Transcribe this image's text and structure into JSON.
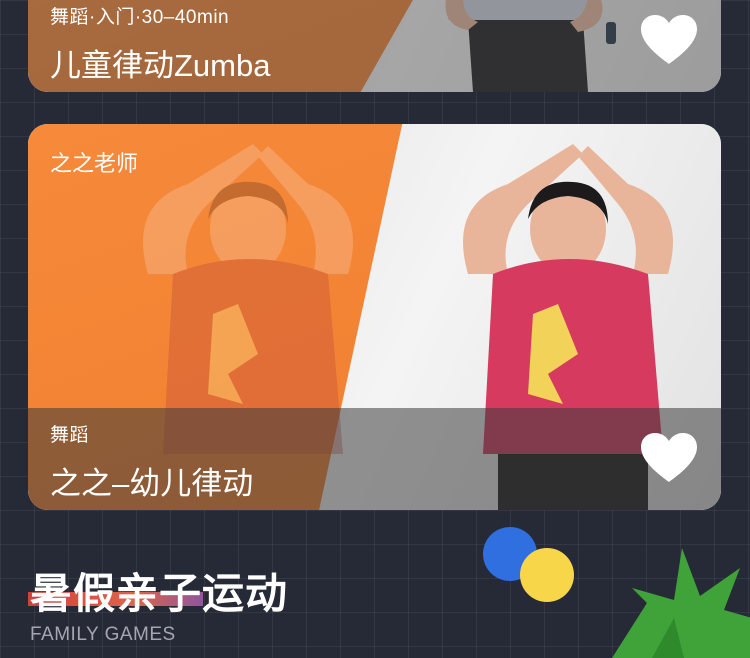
{
  "cards": [
    {
      "tag": "舞蹈·入门·30–40min",
      "title": "儿童律动Zumba",
      "favorite_icon": "heart-icon"
    },
    {
      "teacher": "之之老师",
      "tag": "舞蹈",
      "title": "之之–幼儿律动",
      "favorite_icon": "heart-icon"
    }
  ],
  "section": {
    "title": "暑假亲子运动",
    "subtitle": "FAMILY GAMES"
  },
  "colors": {
    "background": "#262a36",
    "orange": "#f07d2f",
    "accent_blue": "#2f6fe0",
    "accent_yellow": "#f7d64a",
    "leaf_green": "#3fa33a"
  }
}
